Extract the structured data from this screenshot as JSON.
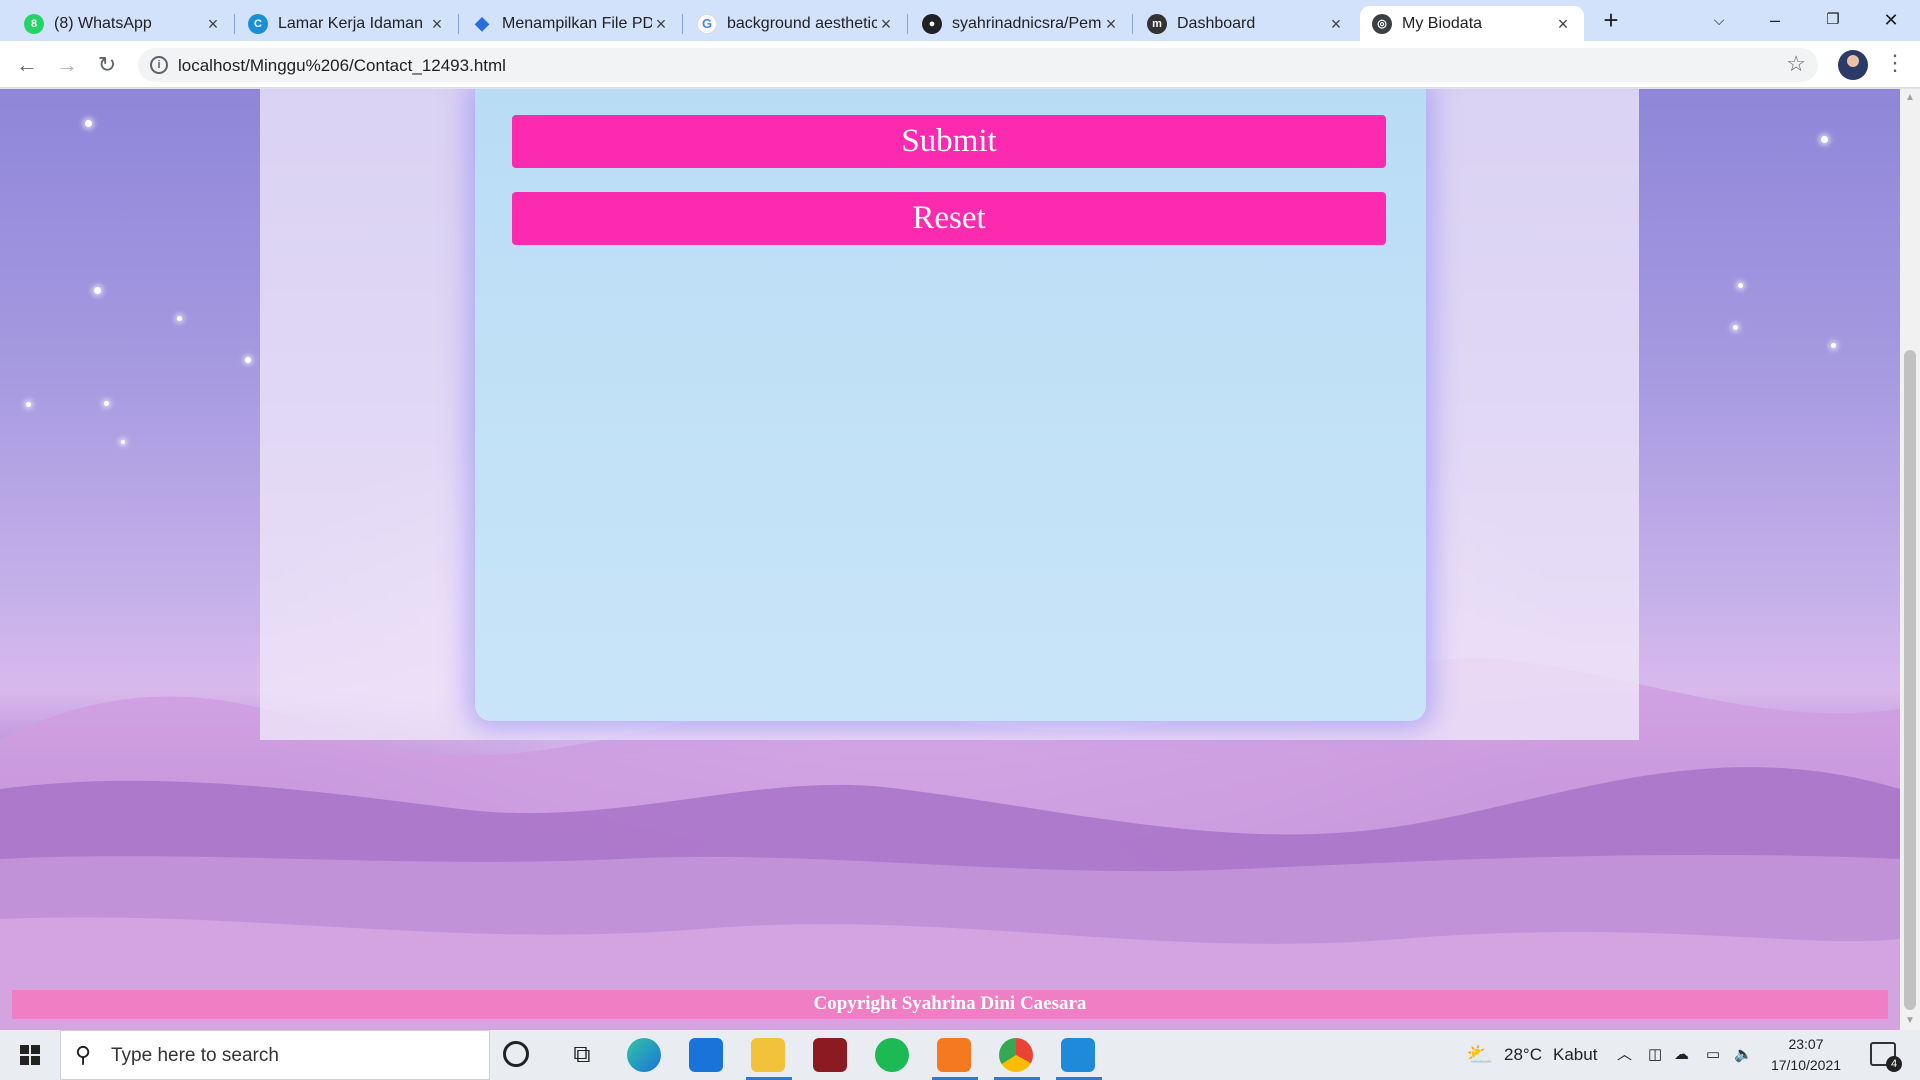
{
  "browser": {
    "tabs": [
      {
        "title": "(8) WhatsApp",
        "icon": "whatsapp-icon",
        "color": "#25d366"
      },
      {
        "title": "Lamar Kerja Idaman di",
        "icon": "canva-icon",
        "color": "#1a8fd6"
      },
      {
        "title": "Menampilkan File PDF",
        "icon": "code-icon",
        "color": "#2a6edb"
      },
      {
        "title": "background aesthetic",
        "icon": "google-icon",
        "color": "#4285f4"
      },
      {
        "title": "syahrinadnicsra/Pem",
        "icon": "github-icon",
        "color": "#202124"
      },
      {
        "title": "Dashboard",
        "icon": "moodle-icon",
        "color": "#333333"
      },
      {
        "title": "My Biodata",
        "icon": "globe-icon",
        "color": "#3c4043",
        "active": true
      }
    ],
    "url": "localhost/Minggu%206/Contact_12493.html"
  },
  "page": {
    "submit_label": "Submit",
    "reset_label": "Reset",
    "footer_text": "Copyright Syahrina Dini Caesara",
    "colors": {
      "button": "#fc2aaf",
      "card": "#bfe0f6",
      "footer": "#f07ec5"
    }
  },
  "taskbar": {
    "search_placeholder": "Type here to search",
    "weather_temp": "28°C",
    "weather_desc": "Kabut",
    "time": "23:07",
    "date": "17/10/2021",
    "notification_count": "4",
    "apps": [
      "cortana-icon",
      "task-view-icon",
      "edge-icon",
      "mail-icon",
      "file-explorer-icon",
      "app-icon",
      "spotify-icon",
      "xampp-icon",
      "chrome-icon",
      "vscode-icon"
    ]
  }
}
